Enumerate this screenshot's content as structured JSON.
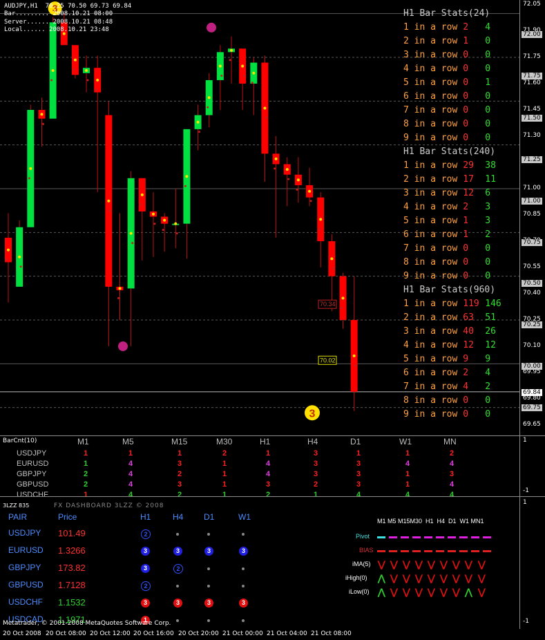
{
  "chart": {
    "symbol_line": "AUDJPY,H1  70.25 70.50 69.73 69.84",
    "bar_time": "Bar......... 2008.10.21 08:00",
    "server_time": "Server...... 2008.10.21 08:48",
    "local_time": "Local...... 2008.10.21 23:48",
    "price_labels": [
      "72.05",
      "71.90",
      "71.75",
      "71.60",
      "71.45",
      "71.30",
      "71.15",
      "71.00",
      "70.85",
      "70.70",
      "70.55",
      "70.40",
      "70.25",
      "70.10",
      "69.95",
      "69.80",
      "69.65"
    ],
    "level_boxes": [
      "72.00",
      "71.75",
      "71.50",
      "71.25",
      "71.00",
      "70.75",
      "70.50",
      "70.25",
      "70.00",
      "69.75"
    ],
    "current_price": "69.84",
    "marker_34": "70.34",
    "marker_02": "70.02",
    "zigzag_top": "3",
    "zigzag_bottom": "3",
    "time_labels": [
      "20 Oct 2008",
      "20 Oct 08:00",
      "20 Oct 12:00",
      "20 Oct 16:00",
      "20 Oct 20:00",
      "21 Oct 00:00",
      "21 Oct 04:00",
      "21 Oct 08:00"
    ],
    "copyright": "Metatrader, © 2001-2008 MetaQuotes Software Corp.",
    "colors": {
      "bull": "#00e040",
      "bear": "#ff0000",
      "grid": "#6a6a6a"
    }
  },
  "stats": [
    {
      "title": "H1 Bar Stats(24)",
      "rows": [
        {
          "label": "1 in a row",
          "r": "2",
          "g": "4"
        },
        {
          "label": "2 in a row",
          "r": "1",
          "g": "0"
        },
        {
          "label": "3 in a row",
          "r": "0",
          "g": "0"
        },
        {
          "label": "4 in a row",
          "r": "0",
          "g": "0"
        },
        {
          "label": "5 in a row",
          "r": "0",
          "g": "1"
        },
        {
          "label": "6 in a row",
          "r": "0",
          "g": "0"
        },
        {
          "label": "7 in a row",
          "r": "0",
          "g": "0"
        },
        {
          "label": "8 in a row",
          "r": "0",
          "g": "0"
        },
        {
          "label": "9 in a row",
          "r": "0",
          "g": "0"
        }
      ]
    },
    {
      "title": "H1 Bar Stats(240)",
      "rows": [
        {
          "label": "1 in a row",
          "r": "29",
          "g": "38"
        },
        {
          "label": "2 in a row",
          "r": "17",
          "g": "11"
        },
        {
          "label": "3 in a row",
          "r": "12",
          "g": "6"
        },
        {
          "label": "4 in a row",
          "r": "2",
          "g": "3"
        },
        {
          "label": "5 in a row",
          "r": "1",
          "g": "3"
        },
        {
          "label": "6 in a row",
          "r": "1",
          "g": "2"
        },
        {
          "label": "7 in a row",
          "r": "0",
          "g": "0"
        },
        {
          "label": "8 in a row",
          "r": "0",
          "g": "0"
        },
        {
          "label": "9 in a row",
          "r": "0",
          "g": "0"
        }
      ]
    },
    {
      "title": "H1 Bar Stats(960)",
      "rows": [
        {
          "label": "1 in a row",
          "r": "119",
          "g": "146"
        },
        {
          "label": "2 in a row",
          "r": "63",
          "g": "51"
        },
        {
          "label": "3 in a row",
          "r": "40",
          "g": "26"
        },
        {
          "label": "4 in a row",
          "r": "12",
          "g": "12"
        },
        {
          "label": "5 in a row",
          "r": "9",
          "g": "9"
        },
        {
          "label": "6 in a row",
          "r": "2",
          "g": "4"
        },
        {
          "label": "7 in a row",
          "r": "4",
          "g": "2"
        },
        {
          "label": "8 in a row",
          "r": "0",
          "g": "0"
        },
        {
          "label": "9 in a row",
          "r": "0",
          "g": "0"
        }
      ]
    }
  ],
  "barcnt": {
    "title": "BarCnt(10)",
    "scale_top": "1",
    "scale_bottom": "-1",
    "timeframes": [
      "M1",
      "M5",
      "M15",
      "M30",
      "H1",
      "H4",
      "D1",
      "W1",
      "MN"
    ],
    "rows": [
      {
        "symbol": "USDJPY",
        "values": [
          [
            "1",
            "#ff2020"
          ],
          [
            "1",
            "#ff2020"
          ],
          [
            "1",
            "#ff2020"
          ],
          [
            "2",
            "#ff2020"
          ],
          [
            "1",
            "#ff2020"
          ],
          [
            "3",
            "#ff2020"
          ],
          [
            "1",
            "#ff2020"
          ],
          [
            "1",
            "#ff2020"
          ],
          [
            "2",
            "#ff2020"
          ]
        ]
      },
      {
        "symbol": "EURUSD",
        "values": [
          [
            "1",
            "#30d030"
          ],
          [
            "4",
            "#e040e0"
          ],
          [
            "3",
            "#ff2020"
          ],
          [
            "1",
            "#ff2020"
          ],
          [
            "4",
            "#e040e0"
          ],
          [
            "3",
            "#ff2020"
          ],
          [
            "3",
            "#ff2020"
          ],
          [
            "4",
            "#e040e0"
          ],
          [
            "4",
            "#e040e0"
          ]
        ]
      },
      {
        "symbol": "GBPJPY",
        "values": [
          [
            "2",
            "#30d030"
          ],
          [
            "4",
            "#e040e0"
          ],
          [
            "2",
            "#ff2020"
          ],
          [
            "1",
            "#ff2020"
          ],
          [
            "4",
            "#e040e0"
          ],
          [
            "3",
            "#ff2020"
          ],
          [
            "3",
            "#ff2020"
          ],
          [
            "1",
            "#ff2020"
          ],
          [
            "3",
            "#ff2020"
          ]
        ]
      },
      {
        "symbol": "GBPUSD",
        "values": [
          [
            "2",
            "#30d030"
          ],
          [
            "4",
            "#e040e0"
          ],
          [
            "3",
            "#ff2020"
          ],
          [
            "1",
            "#ff2020"
          ],
          [
            "3",
            "#ff2020"
          ],
          [
            "2",
            "#ff2020"
          ],
          [
            "3",
            "#ff2020"
          ],
          [
            "1",
            "#ff2020"
          ],
          [
            "4",
            "#e040e0"
          ]
        ]
      },
      {
        "symbol": "USDCHF",
        "values": [
          [
            "1",
            "#ff2020"
          ],
          [
            "4",
            "#30d030"
          ],
          [
            "2",
            "#30d030"
          ],
          [
            "1",
            "#30d030"
          ],
          [
            "2",
            "#30d030"
          ],
          [
            "1",
            "#30d030"
          ],
          [
            "4",
            "#30d030"
          ],
          [
            "4",
            "#30d030"
          ],
          [
            "4",
            "#30d030"
          ]
        ]
      }
    ]
  },
  "dashboard": {
    "pane_id": "3LZZ 835",
    "title": "FX DASHBOARD 3LZZ © 2008",
    "scale_top": "1",
    "scale_bottom": "-1",
    "header_pair": "PAIR",
    "header_price": "Price",
    "timeframes": [
      "H1",
      "H4",
      "D1",
      "W1"
    ],
    "pairs": [
      {
        "symbol": "USDJPY",
        "price": "101.49",
        "price_color": "#ff3030",
        "signals": [
          "2o",
          "dot",
          "dot",
          "dot"
        ]
      },
      {
        "symbol": "EURUSD",
        "price": "1.3266",
        "price_color": "#ff3030",
        "signals": [
          "3b",
          "3b",
          "3b",
          "3b"
        ]
      },
      {
        "symbol": "GBPJPY",
        "price": "173.82",
        "price_color": "#ff3030",
        "signals": [
          "3b",
          "2o",
          "dot",
          "dot"
        ]
      },
      {
        "symbol": "GBPUSD",
        "price": "1.7128",
        "price_color": "#ff3030",
        "signals": [
          "2o",
          "dot",
          "dot",
          "dot"
        ]
      },
      {
        "symbol": "USDCHF",
        "price": "1.1532",
        "price_color": "#30d030",
        "signals": [
          "3r",
          "3r",
          "3r",
          "3r"
        ]
      },
      {
        "symbol": "USDCAD",
        "price": "1.1971",
        "price_color": "#30d030",
        "signals": [
          "1r",
          "dot",
          "dot",
          "dot"
        ]
      }
    ],
    "right_header": "M1 M5 M15M30  H1  H4  D1  W1 MN1",
    "rows": [
      {
        "label": "Pivot",
        "color": "#e020e0"
      },
      {
        "label": "BIAS",
        "color": "#e02020"
      },
      {
        "label": "iMA(5)",
        "arrows": [
          "d",
          "d",
          "d",
          "d",
          "d",
          "d",
          "d",
          "d",
          "d"
        ]
      },
      {
        "label": "iHigh(0)",
        "arrows": [
          "u",
          "d",
          "d",
          "d",
          "d",
          "d",
          "d",
          "d",
          "d"
        ]
      },
      {
        "label": "iLow(0)",
        "arrows": [
          "u",
          "d",
          "d",
          "d",
          "d",
          "d",
          "d",
          "u",
          "d"
        ]
      }
    ],
    "pivot_line_color": "#40e0e0"
  }
}
